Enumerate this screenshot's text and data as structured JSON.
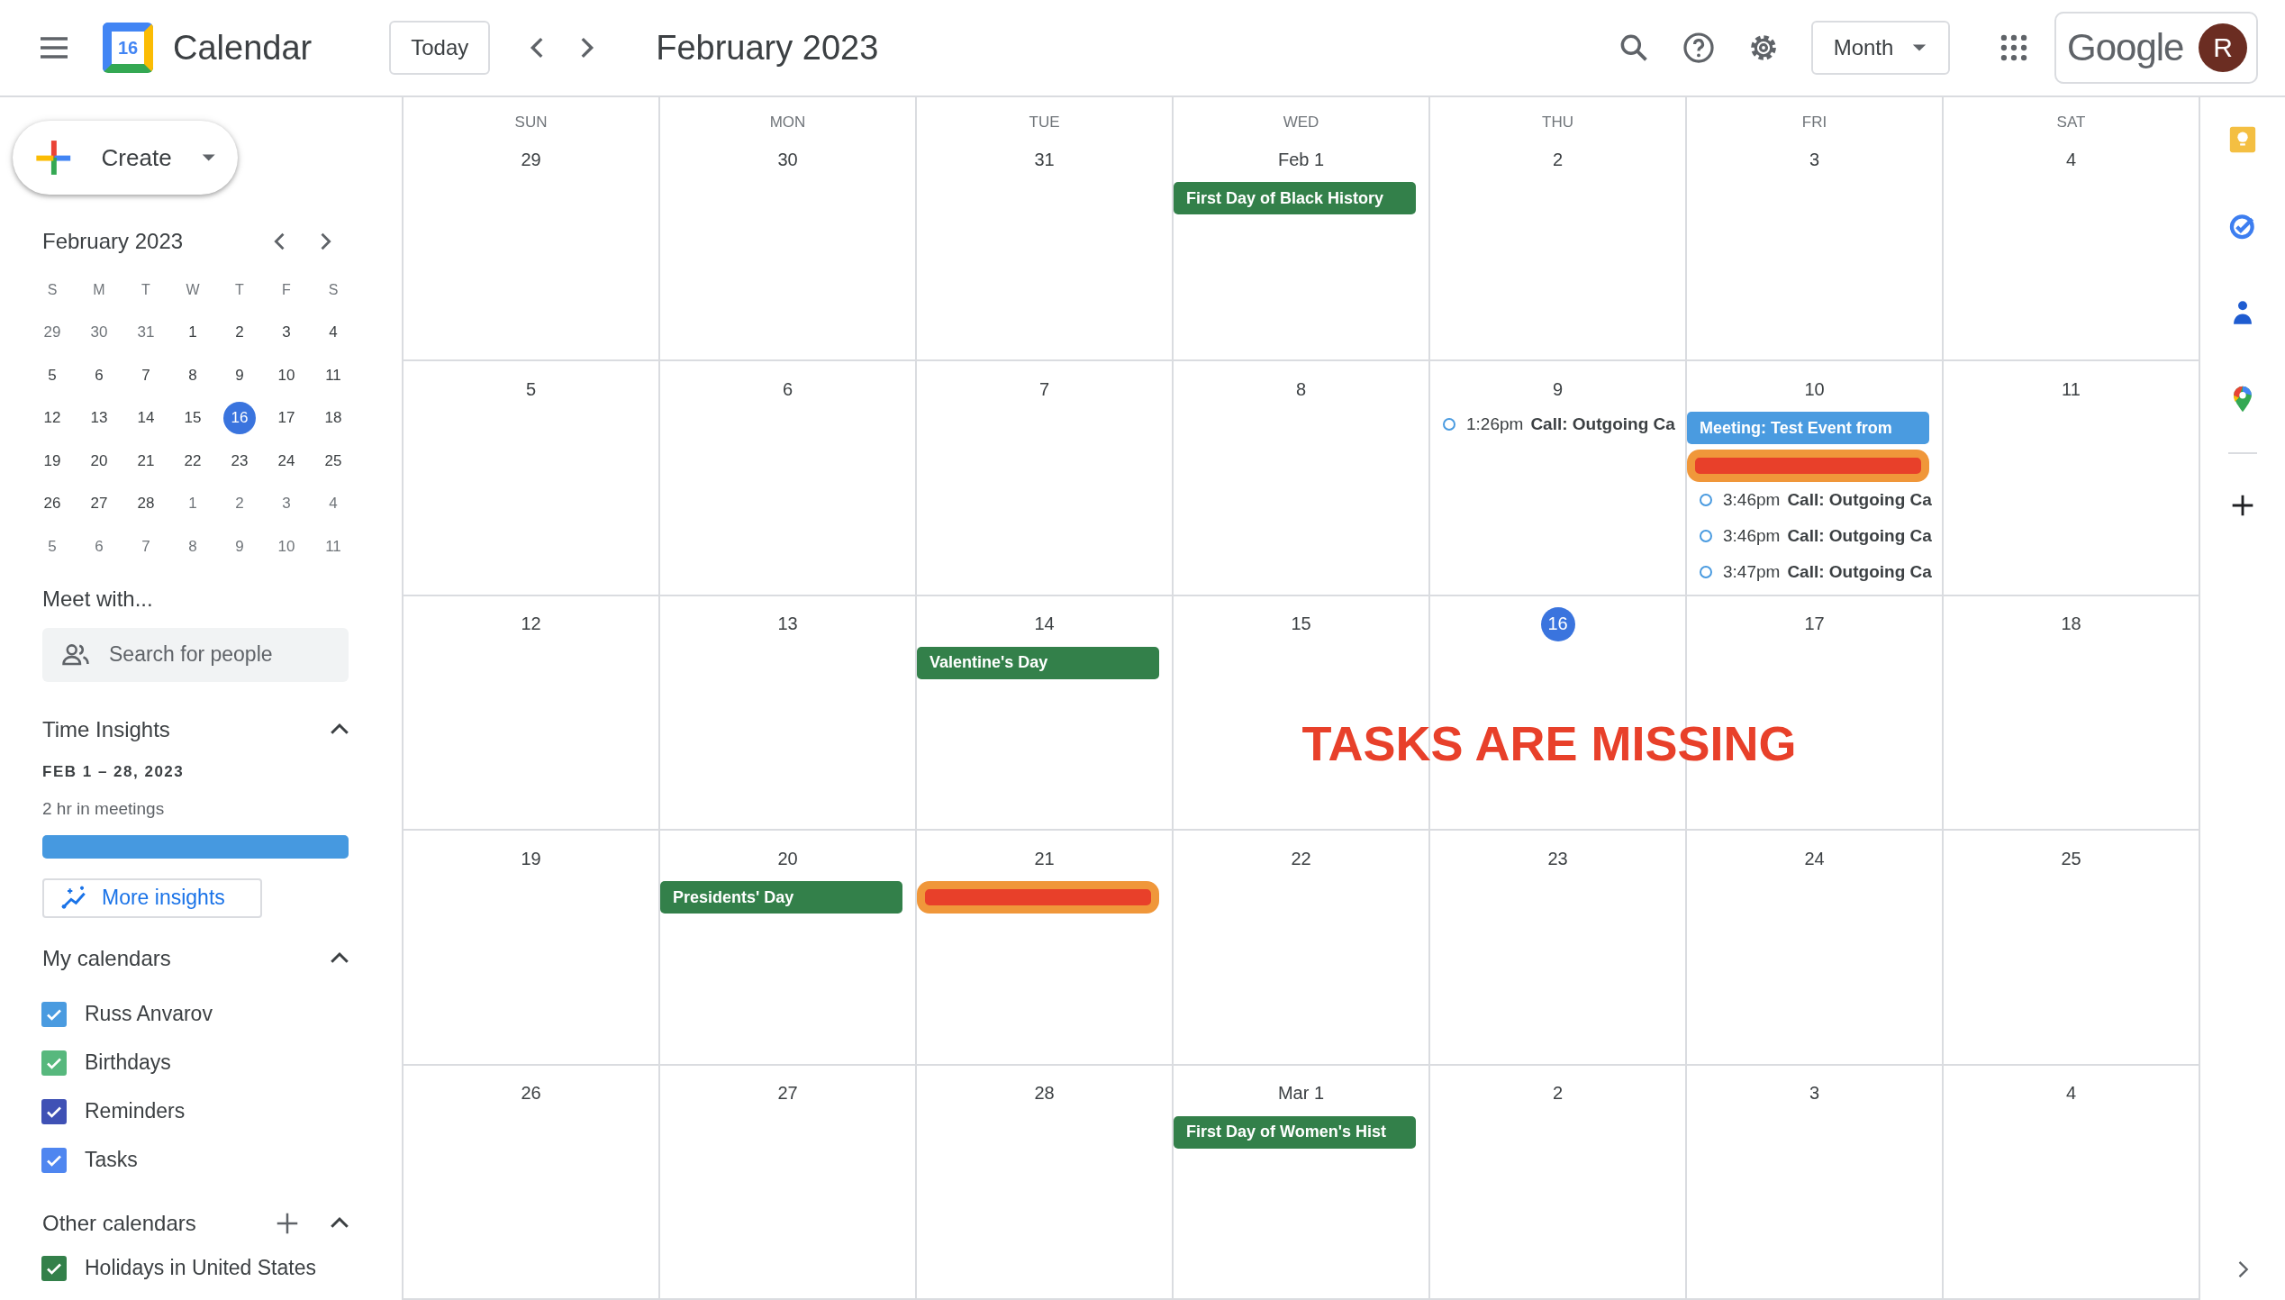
{
  "header": {
    "app_name": "Calendar",
    "logo_day": "16",
    "today_button": "Today",
    "title": "February 2023",
    "view": "Month",
    "brand": "Google",
    "account_initial": "R"
  },
  "sidebar": {
    "create": "Create",
    "mini_calendar": {
      "title": "February 2023",
      "weekdays": [
        "S",
        "M",
        "T",
        "W",
        "T",
        "F",
        "S"
      ],
      "weeks": [
        [
          {
            "label": "29",
            "muted": true,
            "selected": false
          },
          {
            "label": "30",
            "muted": true,
            "selected": false
          },
          {
            "label": "31",
            "muted": true,
            "selected": false
          },
          {
            "label": "1",
            "muted": false,
            "selected": false
          },
          {
            "label": "2",
            "muted": false,
            "selected": false
          },
          {
            "label": "3",
            "muted": false,
            "selected": false
          },
          {
            "label": "4",
            "muted": false,
            "selected": false
          }
        ],
        [
          {
            "label": "5",
            "muted": false,
            "selected": false
          },
          {
            "label": "6",
            "muted": false,
            "selected": false
          },
          {
            "label": "7",
            "muted": false,
            "selected": false
          },
          {
            "label": "8",
            "muted": false,
            "selected": false
          },
          {
            "label": "9",
            "muted": false,
            "selected": false
          },
          {
            "label": "10",
            "muted": false,
            "selected": false
          },
          {
            "label": "11",
            "muted": false,
            "selected": false
          }
        ],
        [
          {
            "label": "12",
            "muted": false,
            "selected": false
          },
          {
            "label": "13",
            "muted": false,
            "selected": false
          },
          {
            "label": "14",
            "muted": false,
            "selected": false
          },
          {
            "label": "15",
            "muted": false,
            "selected": false
          },
          {
            "label": "16",
            "muted": false,
            "selected": true
          },
          {
            "label": "17",
            "muted": false,
            "selected": false
          },
          {
            "label": "18",
            "muted": false,
            "selected": false
          }
        ],
        [
          {
            "label": "19",
            "muted": false,
            "selected": false
          },
          {
            "label": "20",
            "muted": false,
            "selected": false
          },
          {
            "label": "21",
            "muted": false,
            "selected": false
          },
          {
            "label": "22",
            "muted": false,
            "selected": false
          },
          {
            "label": "23",
            "muted": false,
            "selected": false
          },
          {
            "label": "24",
            "muted": false,
            "selected": false
          },
          {
            "label": "25",
            "muted": false,
            "selected": false
          }
        ],
        [
          {
            "label": "26",
            "muted": false,
            "selected": false
          },
          {
            "label": "27",
            "muted": false,
            "selected": false
          },
          {
            "label": "28",
            "muted": false,
            "selected": false
          },
          {
            "label": "1",
            "muted": true,
            "selected": false
          },
          {
            "label": "2",
            "muted": true,
            "selected": false
          },
          {
            "label": "3",
            "muted": true,
            "selected": false
          },
          {
            "label": "4",
            "muted": true,
            "selected": false
          }
        ],
        [
          {
            "label": "5",
            "muted": true,
            "selected": false
          },
          {
            "label": "6",
            "muted": true,
            "selected": false
          },
          {
            "label": "7",
            "muted": true,
            "selected": false
          },
          {
            "label": "8",
            "muted": true,
            "selected": false
          },
          {
            "label": "9",
            "muted": true,
            "selected": false
          },
          {
            "label": "10",
            "muted": true,
            "selected": false
          },
          {
            "label": "11",
            "muted": true,
            "selected": false
          }
        ]
      ]
    },
    "meet_with": {
      "heading": "Meet with...",
      "placeholder": "Search for people"
    },
    "time_insights": {
      "heading": "Time Insights",
      "range": "FEB 1 – 28, 2023",
      "summary": "2 hr in meetings",
      "level": 1,
      "button": "More insights"
    },
    "my_calendars": {
      "heading": "My calendars",
      "items": [
        {
          "label": "Russ Anvarov",
          "checked": true,
          "color": "#4a9be0"
        },
        {
          "label": "Birthdays",
          "checked": true,
          "color": "#57b87d"
        },
        {
          "label": "Reminders",
          "checked": true,
          "color": "#3f51b5"
        },
        {
          "label": "Tasks",
          "checked": true,
          "color": "#4f86f0"
        }
      ]
    },
    "other_calendars": {
      "heading": "Other calendars",
      "items": [
        {
          "label": "Holidays in United States",
          "checked": true,
          "color": "#33804a"
        }
      ]
    }
  },
  "calendar": {
    "weekdays": [
      "SUN",
      "MON",
      "TUE",
      "WED",
      "THU",
      "FRI",
      "SAT"
    ],
    "weeks": [
      [
        {
          "label": "29",
          "today": false
        },
        {
          "label": "30",
          "today": false
        },
        {
          "label": "31",
          "today": false
        },
        {
          "label": "Feb 1",
          "today": false,
          "events": [
            {
              "kind": "allday",
              "text": "First Day of Black History",
              "color": "#33804a"
            }
          ]
        },
        {
          "label": "2",
          "today": false
        },
        {
          "label": "3",
          "today": false
        },
        {
          "label": "4",
          "today": false
        }
      ],
      [
        {
          "label": "5",
          "today": false
        },
        {
          "label": "6",
          "today": false
        },
        {
          "label": "7",
          "today": false
        },
        {
          "label": "8",
          "today": false
        },
        {
          "label": "9",
          "today": false,
          "events": [
            {
              "kind": "timed",
              "time": "1:26pm",
              "text": "Call: Outgoing Ca",
              "color": "#4a9be0"
            }
          ]
        },
        {
          "label": "10",
          "today": false,
          "events": [
            {
              "kind": "allday",
              "text": "Meeting: Test Event from",
              "color": "#4a9be0"
            },
            {
              "kind": "redacted"
            },
            {
              "kind": "timed",
              "time": "3:46pm",
              "text": "Call: Outgoing Ca",
              "color": "#4a9be0"
            },
            {
              "kind": "timed",
              "time": "3:46pm",
              "text": "Call: Outgoing Ca",
              "color": "#4a9be0"
            },
            {
              "kind": "timed",
              "time": "3:47pm",
              "text": "Call: Outgoing Ca",
              "color": "#4a9be0"
            }
          ]
        },
        {
          "label": "11",
          "today": false
        }
      ],
      [
        {
          "label": "12",
          "today": false
        },
        {
          "label": "13",
          "today": false
        },
        {
          "label": "14",
          "today": false,
          "events": [
            {
              "kind": "allday",
              "text": "Valentine's Day",
              "color": "#33804a"
            }
          ]
        },
        {
          "label": "15",
          "today": false
        },
        {
          "label": "16",
          "today": true
        },
        {
          "label": "17",
          "today": false
        },
        {
          "label": "18",
          "today": false
        }
      ],
      [
        {
          "label": "19",
          "today": false
        },
        {
          "label": "20",
          "today": false,
          "events": [
            {
              "kind": "allday",
              "text": "Presidents' Day",
              "color": "#33804a"
            }
          ]
        },
        {
          "label": "21",
          "today": false,
          "events": [
            {
              "kind": "redacted"
            }
          ]
        },
        {
          "label": "22",
          "today": false
        },
        {
          "label": "23",
          "today": false
        },
        {
          "label": "24",
          "today": false
        },
        {
          "label": "25",
          "today": false
        }
      ],
      [
        {
          "label": "26",
          "today": false
        },
        {
          "label": "27",
          "today": false
        },
        {
          "label": "28",
          "today": false
        },
        {
          "label": "Mar 1",
          "today": false,
          "events": [
            {
              "kind": "allday",
              "text": "First Day of Women's Hist",
              "color": "#33804a"
            }
          ]
        },
        {
          "label": "2",
          "today": false
        },
        {
          "label": "3",
          "today": false
        },
        {
          "label": "4",
          "today": false
        }
      ]
    ],
    "annotation": "TASKS ARE MISSING"
  }
}
